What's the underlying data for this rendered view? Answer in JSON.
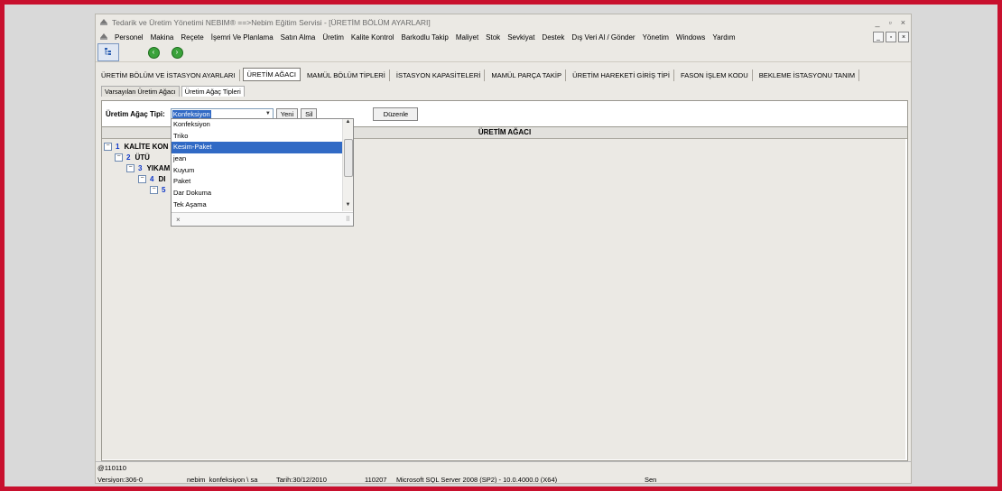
{
  "window": {
    "title": "Tedarik ve Üretim Yönetimi    NEBIM®  ==>Nebim Eğitim Servisi - [ÜRETİM BÖLÜM AYARLARI]",
    "min": "_",
    "max": "▫",
    "close": "×"
  },
  "menu": [
    "Personel",
    "Makina",
    "Reçete",
    "İşemri Ve Planlama",
    "Satın Alma",
    "Üretim",
    "Kalite Kontrol",
    "Barkodlu Takip",
    "Maliyet",
    "Stok",
    "Sevkiyat",
    "Destek",
    "Dış Veri Al / Gönder",
    "Yönetim",
    "Windows",
    "Yardım"
  ],
  "mdi_buttons": [
    "_",
    "▫",
    "×"
  ],
  "tabs": [
    "ÜRETİM BÖLÜM VE İSTASYON AYARLARI",
    "ÜRETİM AĞACI",
    "MAMÜL BÖLÜM TİPLERİ",
    "İSTASYON KAPASİTELERİ",
    "MAMÜL PARÇA TAKİP",
    "ÜRETİM HAREKETİ GİRİŞ TİPİ",
    "FASON İŞLEM KODU",
    "BEKLEME İSTASYONU TANIM"
  ],
  "active_tab": 1,
  "subtabs": [
    "Varsayılan Üretim Ağacı",
    "Üretim Ağaç Tipleri"
  ],
  "active_subtab": 1,
  "filter": {
    "label": "Üretim Ağaç Tipi:",
    "value": "Konfeksiyon",
    "new_button": "Yeni",
    "delete_button": "Sil",
    "edit_button": "Düzenle"
  },
  "tree_header": "ÜRETİM AĞACI",
  "tree": [
    {
      "num": "1",
      "label": "KALİTE KON"
    },
    {
      "num": "2",
      "label": "ÜTÜ"
    },
    {
      "num": "3",
      "label": "YIKAM"
    },
    {
      "num": "4",
      "label": "DI"
    },
    {
      "num": "5",
      "label": ""
    }
  ],
  "dropdown": {
    "items": [
      "Konfeksiyon",
      "Triko",
      "Kesim-Paket",
      "jean",
      "Kuyum",
      "Paket",
      "Dar Dokuma",
      "Tek Aşama"
    ],
    "selected": 2,
    "footer_close": "×"
  },
  "statusbar": {
    "text": "@110110"
  },
  "infobar": {
    "version": "Versiyon:306-0",
    "db": "nebim_konfeksiyon \\ sa",
    "date": "Tarih:30/12/2010",
    "code": "110207",
    "server": "Microsoft SQL Server 2008 (SP2) - 10.0.4000.0 (X64)",
    "day": "Sen"
  }
}
